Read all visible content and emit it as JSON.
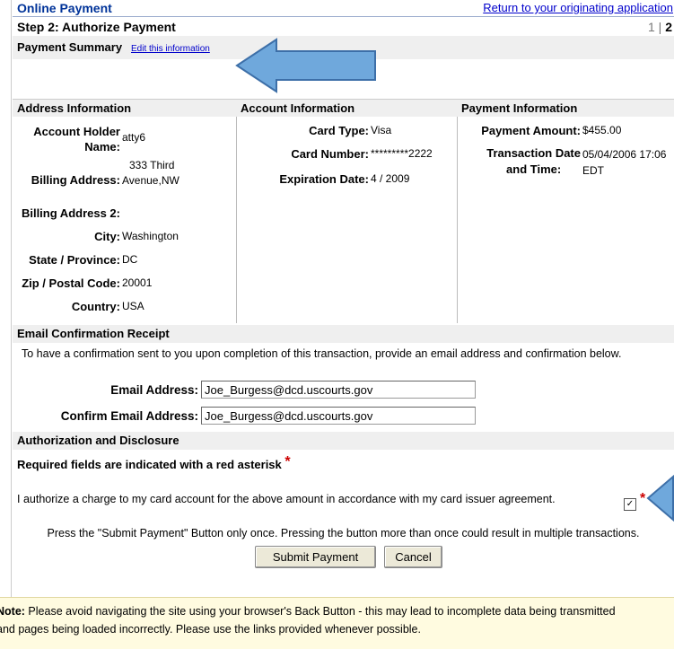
{
  "header": {
    "title": "Online Payment",
    "return_link": "Return to your originating application",
    "step_title": "Step 2: Authorize Payment",
    "pager": {
      "steps": "1 | ",
      "current": "2"
    }
  },
  "summary": {
    "title": "Payment Summary",
    "edit_link": "Edit this information"
  },
  "address": {
    "heading": "Address Information",
    "account_holder_label_1": "Account Holder",
    "account_holder_label_2": "Name:",
    "account_holder_value": "atty6",
    "billing_address_label": "Billing Address:",
    "billing_address_value_1": "333 Third",
    "billing_address_value_2": "Avenue,NW",
    "billing_address2_label": "Billing Address 2:",
    "city_label": "City:",
    "city_value": "Washington",
    "state_label": "State / Province:",
    "state_value": "DC",
    "zip_label": "Zip / Postal Code:",
    "zip_value": "20001",
    "country_label": "Country:",
    "country_value": "USA"
  },
  "account": {
    "heading": "Account Information",
    "card_type_label": "Card Type:",
    "card_type_value": "Visa",
    "card_number_label": "Card Number:",
    "card_number_value": "*********2222",
    "expiration_label": "Expiration Date:",
    "expiration_value": "4 / 2009"
  },
  "payment": {
    "heading": "Payment Information",
    "amount_label": "Payment Amount:",
    "amount_value": "$455.00",
    "datetime_label_1": "Transaction Date",
    "datetime_label_2": "and Time:",
    "datetime_value_1": "05/04/2006 17:06",
    "datetime_value_2": "EDT"
  },
  "email": {
    "heading": "Email Confirmation Receipt",
    "instructions": "To have a confirmation sent to you upon completion of this transaction, provide an email address and confirmation below.",
    "email_label": "Email Address:",
    "email_value": "Joe_Burgess@dcd.uscourts.gov",
    "confirm_label": "Confirm Email Address:",
    "confirm_value": "Joe_Burgess@dcd.uscourts.gov"
  },
  "authorization": {
    "heading": "Authorization and Disclosure",
    "required_note": "Required fields are indicated with a red asterisk",
    "star": "*",
    "agreement_text": "I authorize a charge to my card account for the above amount in accordance with my card issuer agreement.",
    "checkbox_mark": "✓",
    "press_note": "Press the \"Submit Payment\" Button only once. Pressing the button more than once could result in multiple transactions.",
    "submit_label": "Submit Payment",
    "cancel_label": "Cancel"
  },
  "note": {
    "label": "Note:",
    "text_1": " Please avoid navigating the site using your browser's Back Button - this may lead to incomplete data being transmitted",
    "text_2": "and pages being loaded incorrectly. Please use the links provided whenever possible."
  },
  "colors": {
    "accent": "#003399",
    "link": "#0000cc",
    "arrow": "#6fa8dc",
    "required": "#cc0000",
    "note_bg": "#fffbe0"
  }
}
